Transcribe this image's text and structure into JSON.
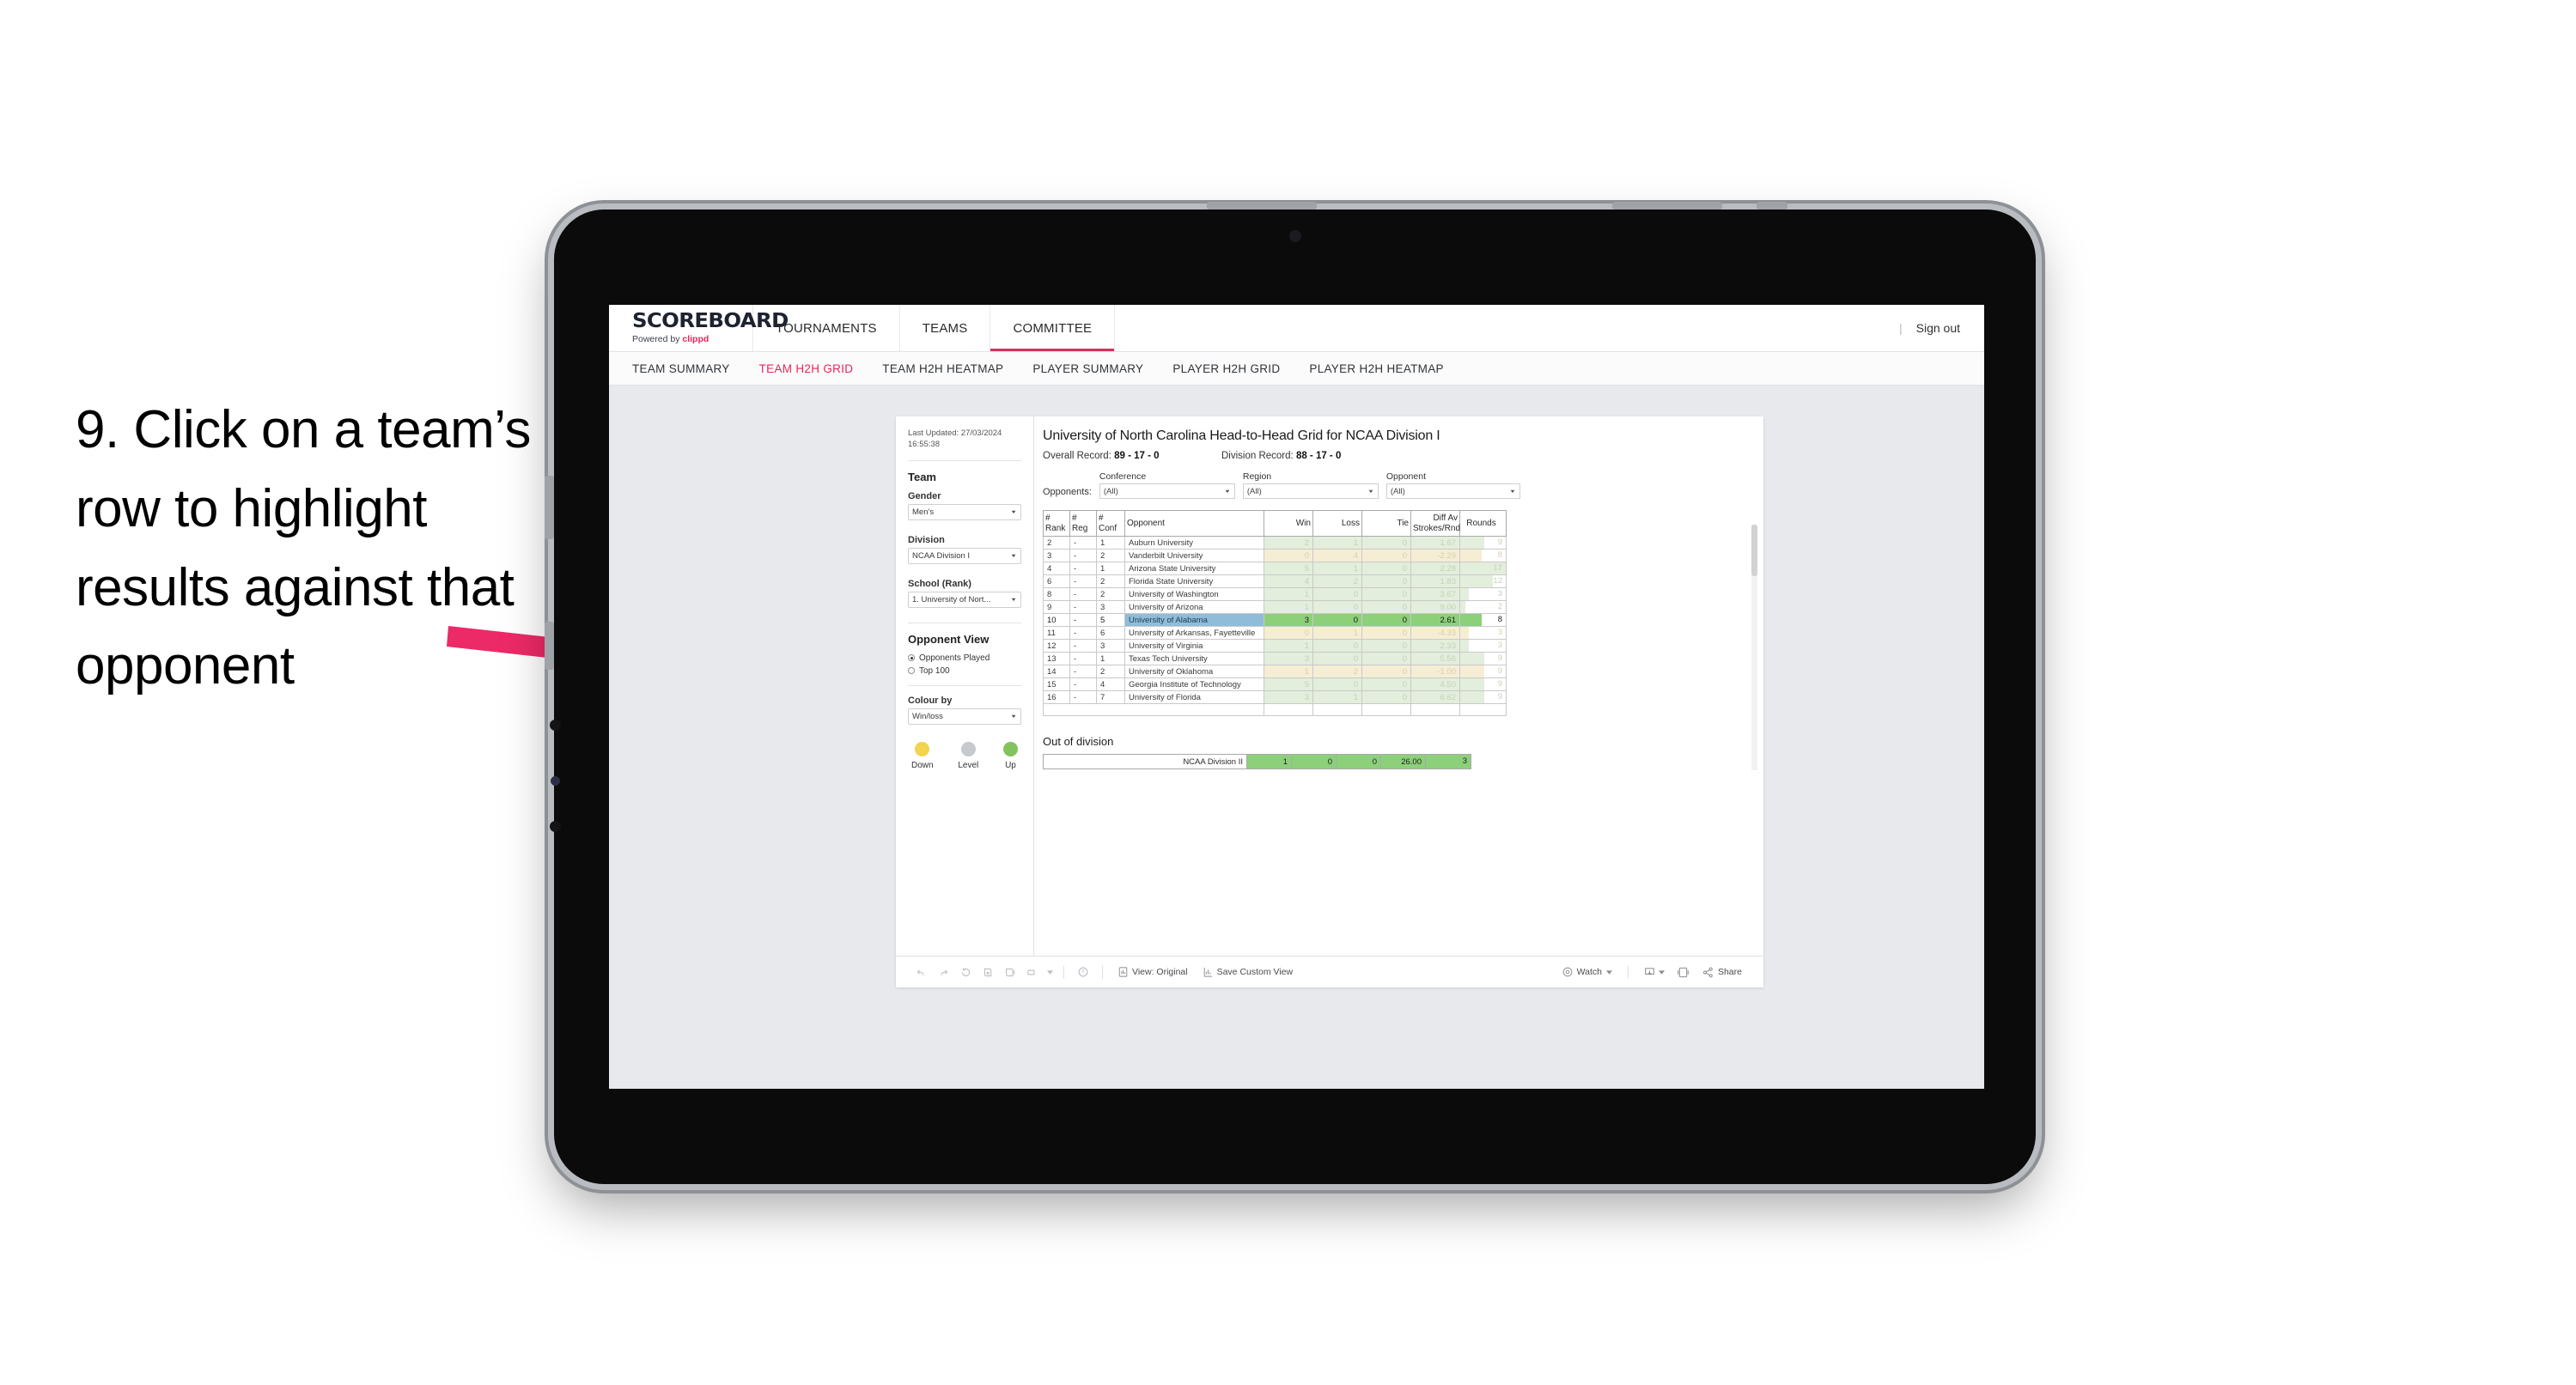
{
  "instruction": {
    "text": "9. Click on a team’s row to highlight results against that opponent"
  },
  "brand": {
    "name": "SCOREBOARD",
    "powered_prefix": "Powered by ",
    "powered_name": "clippd"
  },
  "topnav": {
    "items": [
      {
        "label": "TOURNAMENTS",
        "active": false
      },
      {
        "label": "TEAMS",
        "active": false
      },
      {
        "label": "COMMITTEE",
        "active": true
      }
    ],
    "signout": "Sign out",
    "divider": "|"
  },
  "subnav": {
    "items": [
      {
        "label": "TEAM SUMMARY",
        "active": false
      },
      {
        "label": "TEAM H2H GRID",
        "active": true
      },
      {
        "label": "TEAM H2H HEATMAP",
        "active": false
      },
      {
        "label": "PLAYER SUMMARY",
        "active": false
      },
      {
        "label": "PLAYER H2H GRID",
        "active": false
      },
      {
        "label": "PLAYER H2H HEATMAP",
        "active": false
      }
    ]
  },
  "sidebar": {
    "last_updated": "Last Updated: 27/03/2024 16:55:38",
    "team_heading": "Team",
    "gender_label": "Gender",
    "gender_value": "Men’s",
    "division_label": "Division",
    "division_value": "NCAA Division I",
    "school_label": "School (Rank)",
    "school_value": "1. University of Nort...",
    "opponent_view_heading": "Opponent View",
    "opponent_view_options": [
      {
        "label": "Opponents Played",
        "selected": true
      },
      {
        "label": "Top 100",
        "selected": false
      }
    ],
    "colour_by_label": "Colour by",
    "colour_by_value": "Win/loss",
    "legend": [
      {
        "label": "Down",
        "color": "#f2d44e"
      },
      {
        "label": "Level",
        "color": "#c6c9ce"
      },
      {
        "label": "Up",
        "color": "#82c35e"
      }
    ]
  },
  "main": {
    "title": "University of North Carolina Head-to-Head Grid for NCAA Division I",
    "overall_record_label": "Overall Record:",
    "overall_record_value": "89 - 17 - 0",
    "division_record_label": "Division Record:",
    "division_record_value": "88 - 17 - 0",
    "opponents_label": "Opponents:",
    "filters": [
      {
        "label": "Conference",
        "value": "(All)"
      },
      {
        "label": "Region",
        "value": "(All)"
      },
      {
        "label": "Opponent",
        "value": "(All)"
      }
    ],
    "out_of_division_heading": "Out of division"
  },
  "chart_data": {
    "type": "table",
    "title": "University of North Carolina Head-to-Head Grid for NCAA Division I",
    "columns": [
      "# Rank",
      "# Reg",
      "# Conf",
      "Opponent",
      "Win",
      "Loss",
      "Tie",
      "Diff Av Strokes/Rnd",
      "Rounds"
    ],
    "rounds_max": 17,
    "rows": [
      {
        "rank": "2",
        "reg": "-",
        "conf": "1",
        "opponent": "Auburn University",
        "win": "2",
        "loss": "1",
        "tie": "0",
        "diff": "1.67",
        "rounds": "9",
        "tone": "up",
        "selected": false
      },
      {
        "rank": "3",
        "reg": "-",
        "conf": "2",
        "opponent": "Vanderbilt University",
        "win": "0",
        "loss": "4",
        "tie": "0",
        "diff": "-2.29",
        "rounds": "8",
        "tone": "down",
        "selected": false
      },
      {
        "rank": "4",
        "reg": "-",
        "conf": "1",
        "opponent": "Arizona State University",
        "win": "5",
        "loss": "1",
        "tie": "0",
        "diff": "2.28",
        "rounds": "17",
        "tone": "up",
        "selected": false
      },
      {
        "rank": "6",
        "reg": "-",
        "conf": "2",
        "opponent": "Florida State University",
        "win": "4",
        "loss": "2",
        "tie": "0",
        "diff": "1.83",
        "rounds": "12",
        "tone": "up",
        "selected": false
      },
      {
        "rank": "8",
        "reg": "-",
        "conf": "2",
        "opponent": "University of Washington",
        "win": "1",
        "loss": "0",
        "tie": "0",
        "diff": "3.67",
        "rounds": "3",
        "tone": "up",
        "selected": false
      },
      {
        "rank": "9",
        "reg": "-",
        "conf": "3",
        "opponent": "University of Arizona",
        "win": "1",
        "loss": "0",
        "tie": "0",
        "diff": "9.00",
        "rounds": "2",
        "tone": "up",
        "selected": false
      },
      {
        "rank": "10",
        "reg": "-",
        "conf": "5",
        "opponent": "University of Alabama",
        "win": "3",
        "loss": "0",
        "tie": "0",
        "diff": "2.61",
        "rounds": "8",
        "tone": "up",
        "selected": true
      },
      {
        "rank": "11",
        "reg": "-",
        "conf": "6",
        "opponent": "University of Arkansas, Fayetteville",
        "win": "0",
        "loss": "1",
        "tie": "0",
        "diff": "-4.33",
        "rounds": "3",
        "tone": "down",
        "selected": false
      },
      {
        "rank": "12",
        "reg": "-",
        "conf": "3",
        "opponent": "University of Virginia",
        "win": "1",
        "loss": "0",
        "tie": "0",
        "diff": "2.33",
        "rounds": "3",
        "tone": "up",
        "selected": false
      },
      {
        "rank": "13",
        "reg": "-",
        "conf": "1",
        "opponent": "Texas Tech University",
        "win": "3",
        "loss": "0",
        "tie": "0",
        "diff": "5.56",
        "rounds": "9",
        "tone": "up",
        "selected": false
      },
      {
        "rank": "14",
        "reg": "-",
        "conf": "2",
        "opponent": "University of Oklahoma",
        "win": "1",
        "loss": "2",
        "tie": "0",
        "diff": "-1.00",
        "rounds": "9",
        "tone": "down",
        "selected": false
      },
      {
        "rank": "15",
        "reg": "-",
        "conf": "4",
        "opponent": "Georgia Institute of Technology",
        "win": "5",
        "loss": "0",
        "tie": "0",
        "diff": "4.50",
        "rounds": "9",
        "tone": "up",
        "selected": false
      },
      {
        "rank": "16",
        "reg": "-",
        "conf": "7",
        "opponent": "University of Florida",
        "win": "3",
        "loss": "1",
        "tie": "0",
        "diff": "6.62",
        "rounds": "9",
        "tone": "up",
        "selected": false
      }
    ],
    "out_of_division": [
      {
        "label": "NCAA Division II",
        "win": "1",
        "loss": "0",
        "tie": "0",
        "diff": "26.00",
        "rounds": "3"
      }
    ]
  },
  "toolbar": {
    "view_original": "View: Original",
    "save_custom_view": "Save Custom View",
    "watch": "Watch",
    "share": "Share"
  }
}
